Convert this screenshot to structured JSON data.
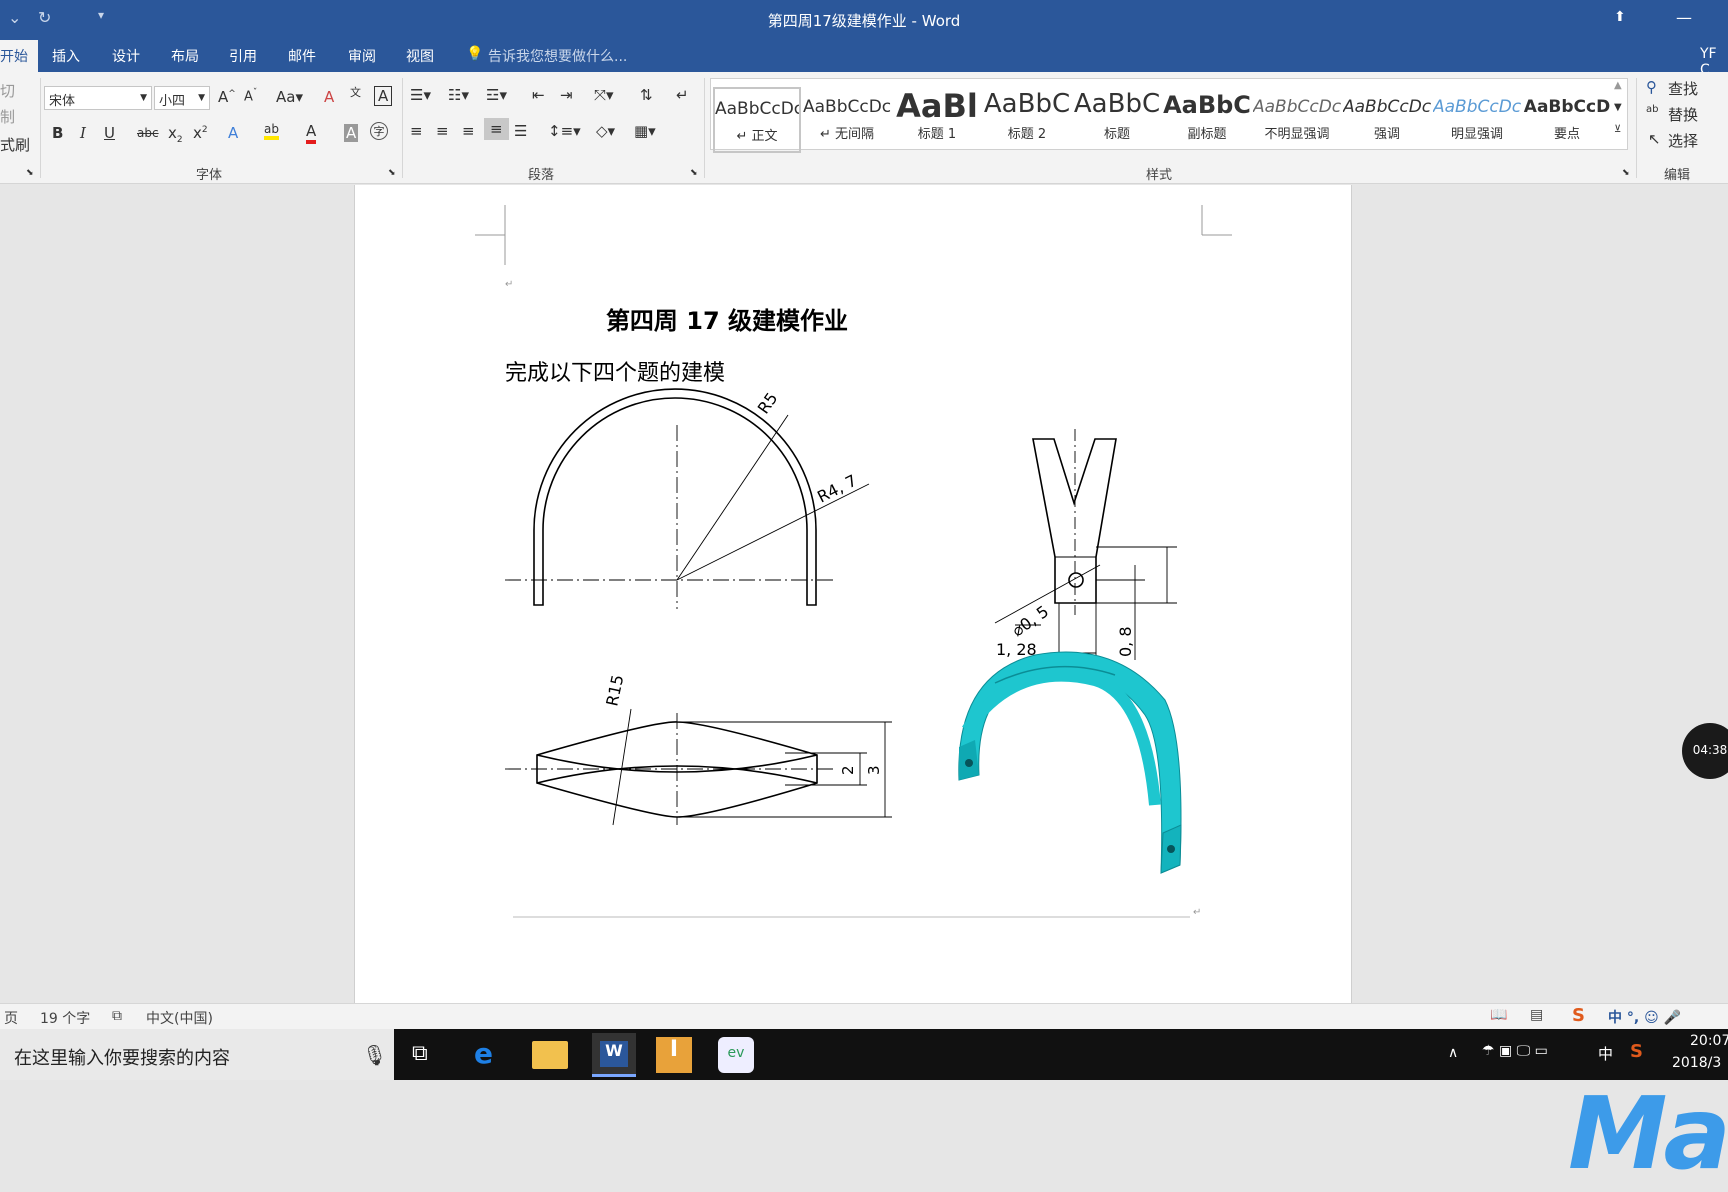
{
  "window": {
    "title": "第四周17级建模作业 - Word",
    "user": "YF C"
  },
  "tabs": [
    "开始",
    "插入",
    "设计",
    "布局",
    "引用",
    "邮件",
    "审阅",
    "视图"
  ],
  "tell_me": "告诉我您想要做什么...",
  "clipboard": {
    "cut": "切",
    "copy": "制",
    "format_painter": "式刷"
  },
  "font": {
    "name": "宋体",
    "size": "小四",
    "group_label": "字体",
    "aa": "Aa"
  },
  "paragraph": {
    "group_label": "段落"
  },
  "styles": {
    "group_label": "样式",
    "items": [
      {
        "preview": "AaBbCcDc",
        "name": "↵ 正文"
      },
      {
        "preview": "AaBbCcDc",
        "name": "↵ 无间隔"
      },
      {
        "preview": "AaBl",
        "name": "标题 1"
      },
      {
        "preview": "AaBbC",
        "name": "标题 2"
      },
      {
        "preview": "AaBbC",
        "name": "标题"
      },
      {
        "preview": "AaBbC",
        "name": "副标题"
      },
      {
        "preview": "AaBbCcDc",
        "name": "不明显强调"
      },
      {
        "preview": "AaBbCcDc",
        "name": "强调"
      },
      {
        "preview": "AaBbCcDc",
        "name": "明显强调"
      },
      {
        "preview": "AaBbCcD",
        "name": "要点"
      }
    ]
  },
  "editing": {
    "find": "查找",
    "replace": "替换",
    "select": "选择",
    "group_label": "编辑"
  },
  "document": {
    "heading": "第四周 17 级建模作业",
    "subheading": "完成以下四个题的建模",
    "dims": {
      "r5": "R5",
      "r47": "R4, 7",
      "phi": "⌀0, 5",
      "d128": "1, 28",
      "d08": "0, 8",
      "r15": "R15",
      "d2": "2",
      "d3": "3"
    }
  },
  "status": {
    "page": "页",
    "words": "19 个字",
    "language": "中文(中国)"
  },
  "taskbar": {
    "search_placeholder": "在这里输入你要搜索的内容",
    "time": "20:07",
    "date": "2018/3",
    "ime": "中"
  },
  "recorder": {
    "time": "04:38"
  },
  "watermark": "Ma",
  "colors": {
    "accent": "#2b579a",
    "model": "#19c8d2"
  }
}
